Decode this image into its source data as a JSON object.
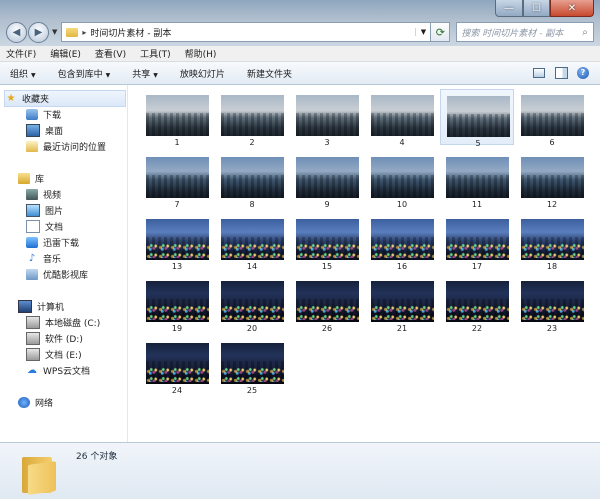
{
  "window": {
    "caption_buttons": {
      "minimize": "—",
      "maximize": "☐",
      "close": "✕"
    }
  },
  "navigation": {
    "back": "◀",
    "forward": "▶",
    "history_dropdown": "▼",
    "address_separator": "▸",
    "address_path": "时间切片素材 - 副本",
    "address_dropdown": "▼",
    "refresh": "⟳",
    "search_placeholder": "搜索 时间切片素材 - 副本",
    "search_icon": "⌕"
  },
  "menu": [
    "文件(F)",
    "编辑(E)",
    "查看(V)",
    "工具(T)",
    "帮助(H)"
  ],
  "commands": [
    {
      "label": "组织",
      "dropdown": true
    },
    {
      "label": "包含到库中",
      "dropdown": true
    },
    {
      "label": "共享",
      "dropdown": true
    },
    {
      "label": "放映幻灯片",
      "dropdown": false
    },
    {
      "label": "新建文件夹",
      "dropdown": false
    }
  ],
  "command_dropdown_arrow": "▼",
  "command_icons": [
    "view-options-icon",
    "preview-pane-icon",
    "help-icon"
  ],
  "help_glyph": "?",
  "sidebar": {
    "favorites": {
      "label": "收藏夹",
      "icon": "star-icon",
      "items": [
        {
          "label": "下载",
          "icon": "downloads-icon"
        },
        {
          "label": "桌面",
          "icon": "desktop-icon"
        },
        {
          "label": "最近访问的位置",
          "icon": "recent-places-icon"
        }
      ]
    },
    "libraries": {
      "label": "库",
      "icon": "library-icon",
      "items": [
        {
          "label": "视频",
          "icon": "video-icon"
        },
        {
          "label": "图片",
          "icon": "pictures-icon"
        },
        {
          "label": "文档",
          "icon": "documents-icon"
        },
        {
          "label": "迅雷下载",
          "icon": "thunder-icon"
        },
        {
          "label": "音乐",
          "icon": "music-icon"
        },
        {
          "label": "优酷影视库",
          "icon": "youku-icon"
        }
      ]
    },
    "computer": {
      "label": "计算机",
      "icon": "computer-icon",
      "items": [
        {
          "label": "本地磁盘 (C:)",
          "icon": "drive-icon"
        },
        {
          "label": "软件 (D:)",
          "icon": "drive-icon"
        },
        {
          "label": "文档 (E:)",
          "icon": "drive-icon"
        },
        {
          "label": "WPS云文档",
          "icon": "wps-cloud-icon"
        }
      ]
    },
    "network": {
      "label": "网络",
      "icon": "network-icon"
    }
  },
  "files": [
    {
      "name": "1",
      "tone": "day"
    },
    {
      "name": "2",
      "tone": "day"
    },
    {
      "name": "3",
      "tone": "day"
    },
    {
      "name": "4",
      "tone": "day"
    },
    {
      "name": "5",
      "tone": "day",
      "selected": true
    },
    {
      "name": "6",
      "tone": "day"
    },
    {
      "name": "7",
      "tone": "dusk"
    },
    {
      "name": "8",
      "tone": "dusk"
    },
    {
      "name": "9",
      "tone": "dusk"
    },
    {
      "name": "10",
      "tone": "dusk"
    },
    {
      "name": "11",
      "tone": "dusk"
    },
    {
      "name": "12",
      "tone": "dusk"
    },
    {
      "name": "13",
      "tone": "blue"
    },
    {
      "name": "14",
      "tone": "blue"
    },
    {
      "name": "15",
      "tone": "blue"
    },
    {
      "name": "16",
      "tone": "blue"
    },
    {
      "name": "17",
      "tone": "blue"
    },
    {
      "name": "18",
      "tone": "blue"
    },
    {
      "name": "19",
      "tone": "night"
    },
    {
      "name": "20",
      "tone": "night"
    },
    {
      "name": "26",
      "tone": "night"
    },
    {
      "name": "21",
      "tone": "night"
    },
    {
      "name": "22",
      "tone": "night"
    },
    {
      "name": "23",
      "tone": "night"
    },
    {
      "name": "24",
      "tone": "night"
    },
    {
      "name": "25",
      "tone": "night"
    }
  ],
  "details": {
    "count_text": "26 个对象"
  }
}
